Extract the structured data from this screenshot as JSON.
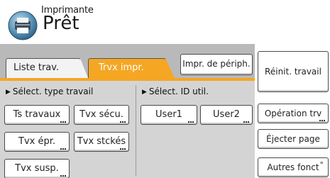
{
  "header": {
    "app_title": "Imprimante",
    "status": "Prêt",
    "icon": "printer-icon"
  },
  "tabs": [
    {
      "label": "Liste trav.",
      "active": false
    },
    {
      "label": "Trvx impr.",
      "active": true
    }
  ],
  "toolbar": {
    "impr_periph_label": "Impr. de périph."
  },
  "sections": {
    "job_type_label": "Sélect. type travail",
    "user_id_label": "Sélect. ID util."
  },
  "job_type_buttons": {
    "ts_travaux": "Ts travaux",
    "tvx_secu": "Tvx sécu.",
    "tvx_epr": "Tvx épr.",
    "tvx_stckes": "Tvx stckés",
    "tvx_susp": "Tvx susp."
  },
  "user_buttons": {
    "user1": "User1",
    "user2": "User2"
  },
  "side": {
    "reinit_label": "Réinit. travail",
    "operation_label": "Opération trv",
    "ejecter_label": "Éjecter page",
    "autres_label": "Autres fonct"
  },
  "colors": {
    "accent": "#f5a623",
    "panel_top": "#b9b9b9",
    "panel_body": "#d4d4d4"
  }
}
